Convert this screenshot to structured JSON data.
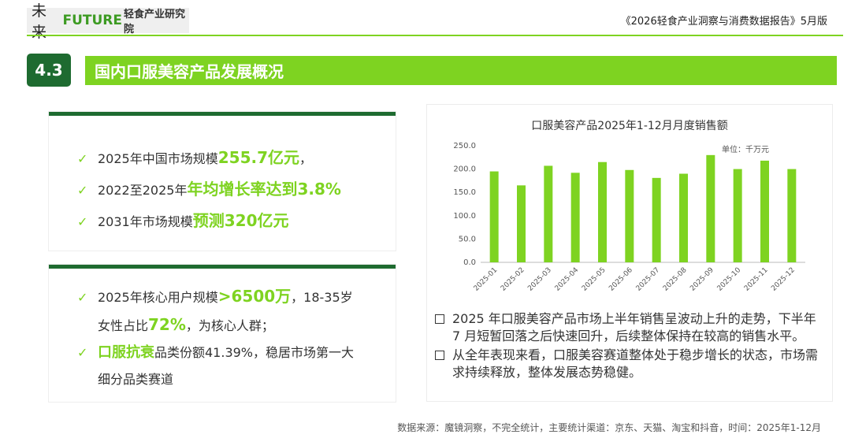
{
  "header": {
    "logo_cn": "未来",
    "logo_en": "FUTURE",
    "logo_tail": "轻食产业研究院",
    "report_title": "《2026轻食产业洞察与消费数据报告》5月版"
  },
  "section": {
    "number": "4.3",
    "title": "国内口服美容产品发展概况"
  },
  "card1": {
    "items": [
      {
        "pre": "2025年中国市场规模",
        "hl": "255.7亿元",
        "post": "，"
      },
      {
        "pre": "2022至2025年",
        "hl": "年均增长率达到3.8%",
        "post": ""
      },
      {
        "pre": "2031年市场规模",
        "hl": "预测320亿元",
        "post": ""
      }
    ]
  },
  "card2": {
    "l1_pre": "2025年核心用户规模",
    "l1_hl": ">6500万",
    "l1_post": "，18-35岁",
    "l2_pre": "女性占比",
    "l2_hl": "72%",
    "l2_post": "，为核心人群；",
    "l3_hl": "口服抗衰",
    "l3_post": "品类份额41.39%，稳居市场第一大",
    "l4": "细分品类赛道"
  },
  "chart_data": {
    "type": "bar",
    "title": "口服美容产品2025年1-12月月度销售额",
    "unit": "单位：千万元",
    "categories": [
      "2025-01",
      "2025-02",
      "2025-03",
      "2025-04",
      "2025-05",
      "2025-06",
      "2025-07",
      "2025-08",
      "2025-09",
      "2025-10",
      "2025-11",
      "2025-12"
    ],
    "values": [
      195,
      165,
      207,
      192,
      215,
      198,
      181,
      190,
      230,
      200,
      218,
      200
    ],
    "ylim": [
      0,
      250
    ],
    "yticks": [
      "0.0",
      "50.0",
      "100.0",
      "150.0",
      "200.0",
      "250.0"
    ],
    "color": "#7ed321",
    "grid": false
  },
  "notes": [
    "2025 年口服美容产品市场上半年销售呈波动上升的走势，下半年 7 月短暂回落之后快速回升，后续整体保持在较高的销售水平。",
    "从全年表现来看，口服美容赛道整体处于稳步增长的状态，市场需求持续释放，整体发展态势稳健。"
  ],
  "footer": "数据来源：魔镜洞察，不完全统计，主要统计渠道：京东、天猫、淘宝和抖音，时间：2025年1-12月"
}
